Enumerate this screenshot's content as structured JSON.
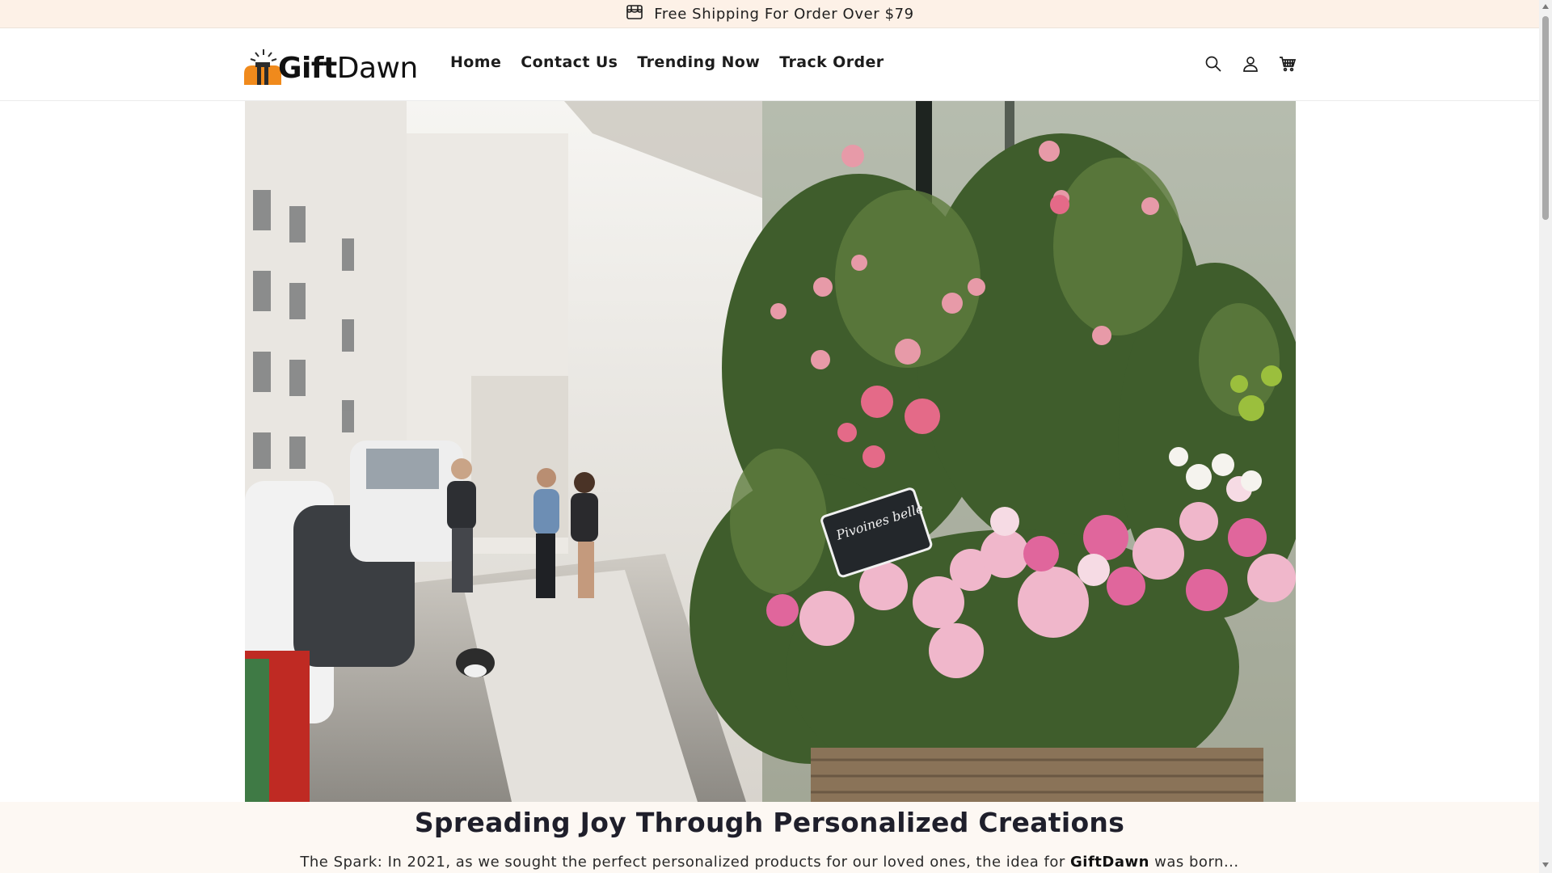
{
  "announcement": {
    "text": "Free Shipping For Order Over $79",
    "icon": "store-icon"
  },
  "header": {
    "logo": {
      "gift": "Gift",
      "dawn": "Dawn"
    },
    "nav": [
      "Home",
      "Contact Us",
      "Trending Now",
      "Track Order"
    ],
    "icons": [
      "search-icon",
      "account-icon",
      "cart-icon"
    ]
  },
  "hero": {
    "sign_text": "Pivoines  belle"
  },
  "story": {
    "title": "Spreading Joy Through Personalized Creations",
    "body_before": "The Spark: In 2021, as we sought the perfect personalized products for our loved ones, the idea for ",
    "body_brand": "GiftDawn",
    "body_after": " was born..."
  },
  "colors": {
    "announce_bg": "#fdf1e7",
    "logo_orange": "#f08a1c",
    "text_dark": "#1f1f2b"
  }
}
